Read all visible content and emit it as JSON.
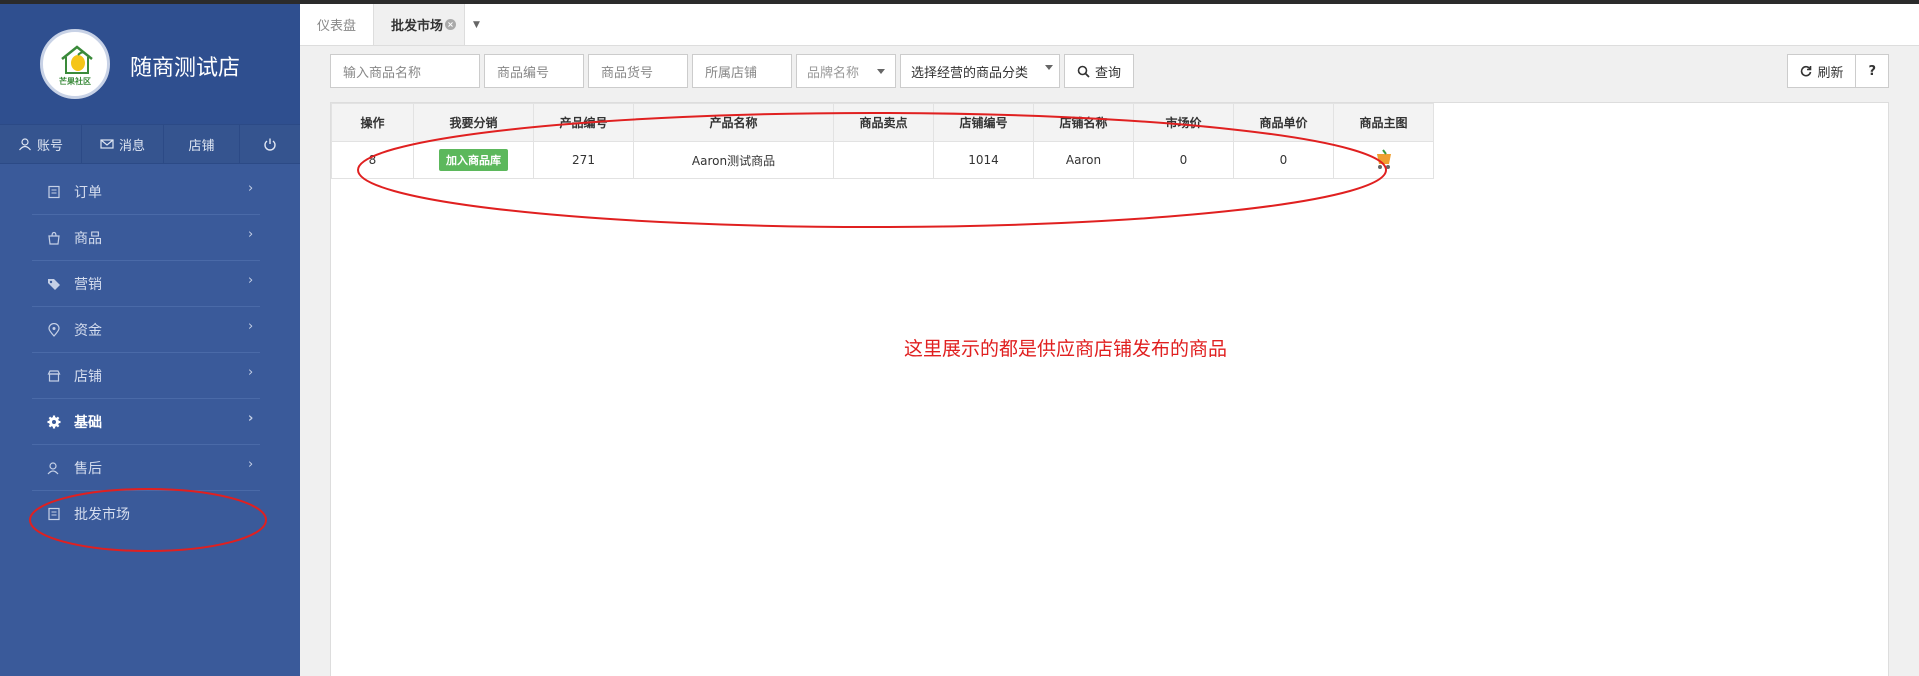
{
  "store": {
    "name": "随商测试店",
    "logo_text": "芒果社区"
  },
  "quickbar": {
    "account": "账号",
    "messages": "消息",
    "shop": "店铺"
  },
  "menu": [
    {
      "label": "订单",
      "icon": "clipboard-icon"
    },
    {
      "label": "商品",
      "icon": "bag-icon"
    },
    {
      "label": "营销",
      "icon": "tag-icon"
    },
    {
      "label": "资金",
      "icon": "location-icon"
    },
    {
      "label": "店铺",
      "icon": "store-icon"
    },
    {
      "label": "基础",
      "icon": "gear-icon"
    },
    {
      "label": "售后",
      "icon": "user-icon"
    },
    {
      "label": "批发市场",
      "icon": "clipboard-icon"
    }
  ],
  "tabs": {
    "dashboard": "仪表盘",
    "wholesale": "批发市场"
  },
  "filters": {
    "product_name_placeholder": "输入商品名称",
    "product_code_placeholder": "商品编号",
    "product_sku_placeholder": "商品货号",
    "shop_placeholder": "所属店铺",
    "brand_placeholder": "品牌名称",
    "category_value": "选择经营的商品分类",
    "search_label": "查询"
  },
  "actions": {
    "refresh": "刷新",
    "help": "?"
  },
  "table": {
    "headers": [
      "操作",
      "我要分销",
      "产品编号",
      "产品名称",
      "商品卖点",
      "店铺编号",
      "店铺名称",
      "市场价",
      "商品单价",
      "商品主图"
    ],
    "rows": [
      {
        "op": "8",
        "distribute": "加入商品库",
        "product_no": "271",
        "product_name": "Aaron测试商品",
        "selling_point": "",
        "shop_no": "1014",
        "shop_name": "Aaron",
        "market_price": "0",
        "unit_price": "0"
      }
    ]
  },
  "annotation": "这里展示的都是供应商店铺发布的商品",
  "colors": {
    "sidebar": "#3a5a9a",
    "accent_green": "#5cb85c",
    "annotation_red": "#e02020"
  }
}
